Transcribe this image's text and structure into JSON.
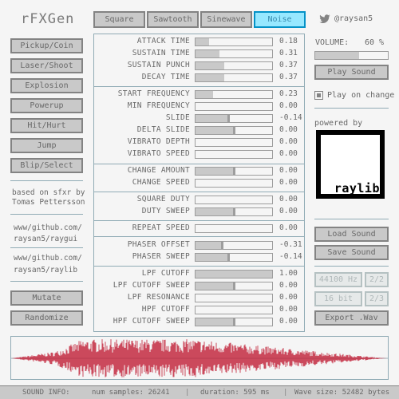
{
  "app": {
    "title": "rFXGen"
  },
  "wave_tabs": [
    {
      "label": "Square",
      "active": false
    },
    {
      "label": "Sawtooth",
      "active": false
    },
    {
      "label": "Sinewave",
      "active": false
    },
    {
      "label": "Noise",
      "active": true
    }
  ],
  "author": {
    "icon": "twitter-icon",
    "handle": "@raysan5"
  },
  "left_buttons": {
    "pickup": "Pickup/Coin",
    "laser": "Laser/Shoot",
    "explosion": "Explosion",
    "powerup": "Powerup",
    "hit": "Hit/Hurt",
    "jump": "Jump",
    "blip": "Blip/Select",
    "mutate": "Mutate",
    "randomize": "Randomize"
  },
  "credits": {
    "line1": "based on sfxr by",
    "line2": "Tomas Pettersson",
    "raygui_1": "www/github.com/",
    "raygui_2": "raysan5/raygui",
    "raylib_1": "www/github.com/",
    "raylib_2": "raysan5/raylib"
  },
  "params": [
    {
      "label": "ATTACK TIME",
      "value": "0.18",
      "level": 0.18
    },
    {
      "label": "SUSTAIN TIME",
      "value": "0.31",
      "level": 0.31
    },
    {
      "label": "SUSTAIN PUNCH",
      "value": "0.37",
      "level": 0.37
    },
    {
      "label": "DECAY TIME",
      "value": "0.37",
      "level": 0.37
    },
    {
      "label": "START FREQUENCY",
      "value": "0.23",
      "level": 0.23
    },
    {
      "label": "MIN FREQUENCY",
      "value": "0.00",
      "level": 0.0
    },
    {
      "label": "SLIDE",
      "value": "-0.14",
      "level": -0.14,
      "bipolar": true
    },
    {
      "label": "DELTA SLIDE",
      "value": "0.00",
      "level": 0.0,
      "bipolar": true
    },
    {
      "label": "VIBRATO DEPTH",
      "value": "0.00",
      "level": 0.0
    },
    {
      "label": "VIBRATO SPEED",
      "value": "0.00",
      "level": 0.0
    },
    {
      "label": "CHANGE AMOUNT",
      "value": "0.00",
      "level": 0.0,
      "bipolar": true
    },
    {
      "label": "CHANGE SPEED",
      "value": "0.00",
      "level": 0.0
    },
    {
      "label": "SQUARE DUTY",
      "value": "0.00",
      "level": 0.0
    },
    {
      "label": "DUTY SWEEP",
      "value": "0.00",
      "level": 0.0,
      "bipolar": true
    },
    {
      "label": "REPEAT SPEED",
      "value": "0.00",
      "level": 0.0
    },
    {
      "label": "PHASER OFFSET",
      "value": "-0.31",
      "level": -0.31,
      "bipolar": true
    },
    {
      "label": "PHASER SWEEP",
      "value": "-0.14",
      "level": -0.14,
      "bipolar": true
    },
    {
      "label": "LPF CUTOFF",
      "value": "1.00",
      "level": 1.0
    },
    {
      "label": "LPF CUTOFF SWEEP",
      "value": "0.00",
      "level": 0.0,
      "bipolar": true
    },
    {
      "label": "LPF RESONANCE",
      "value": "0.00",
      "level": 0.0
    },
    {
      "label": "HPF CUTOFF",
      "value": "0.00",
      "level": 0.0
    },
    {
      "label": "HPF CUTOFF SWEEP",
      "value": "0.00",
      "level": 0.0,
      "bipolar": true
    }
  ],
  "volume": {
    "label": "VOLUME:",
    "value": "60 %",
    "level": 0.6
  },
  "right": {
    "play_sound": "Play Sound",
    "play_on_change": "Play on change",
    "play_on_change_checked": true,
    "powered_by": "powered by",
    "logo_text": "raylib",
    "load_sound": "Load Sound",
    "save_sound": "Save Sound",
    "sample_rate": "44100 Hz",
    "sample_rate_toggle": "2/2",
    "bit_depth": "16 bit",
    "bit_depth_toggle": "2/3",
    "export_wav": "Export .Wav"
  },
  "status": {
    "info": "SOUND INFO:",
    "samples": "num samples: 26241",
    "duration": "duration: 595 ms",
    "wave_size": "Wave size: 52482 bytes"
  },
  "colors": {
    "waveform": "#c11e36",
    "accent": "#97e8ff",
    "border": "#838383"
  }
}
